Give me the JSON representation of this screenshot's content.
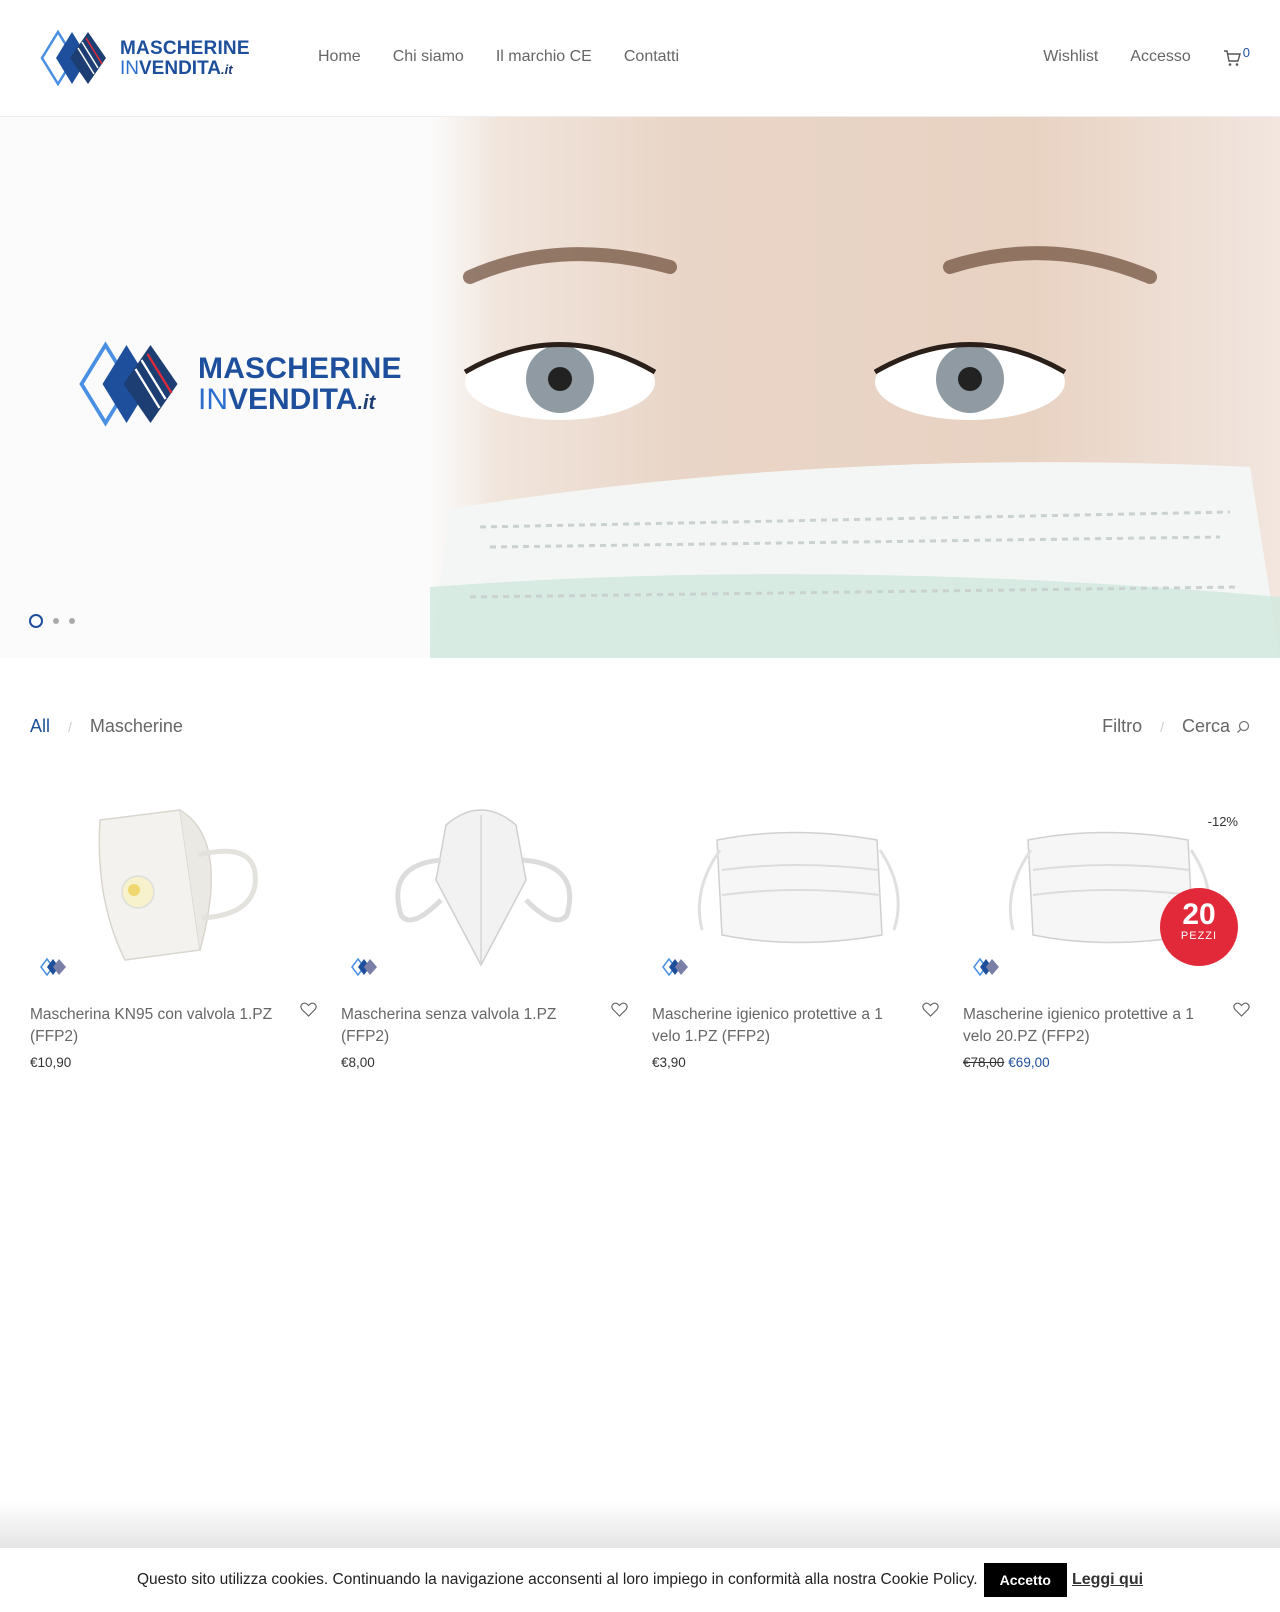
{
  "header": {
    "logo": {
      "line1": "MASCHERINE",
      "line2_in": "IN",
      "line2_vendita": "VENDITA",
      "tld": ".it"
    },
    "nav": [
      "Home",
      "Chi siamo",
      "Il marchio CE",
      "Contatti"
    ],
    "wishlist_label": "Wishlist",
    "login_label": "Accesso",
    "cart_count": "0"
  },
  "hero": {
    "logo": {
      "line1": "MASCHERINE",
      "line2_in": "IN",
      "line2_vendita": "VENDITA",
      "tld": ".it"
    },
    "slides": 3,
    "active_slide": 1
  },
  "filters": {
    "categories": [
      "All",
      "Mascherine"
    ],
    "filter_label": "Filtro",
    "search_label": "Cerca"
  },
  "products": [
    {
      "title": "Mascherina KN95 con valvola 1.PZ (FFP2)",
      "price": "€10,90"
    },
    {
      "title": "Mascherina senza valvola 1.PZ (FFP2)",
      "price": "€8,00"
    },
    {
      "title": "Mascherine igienico protettive a 1 velo 1.PZ (FFP2)",
      "price": "€3,90"
    },
    {
      "title": "Mascherine igienico protettive a 1 velo 20.PZ (FFP2)",
      "old_price": "€78,00",
      "price": "€69,00",
      "sale_badge": "-12%",
      "qty_badge_number": "20",
      "qty_badge_label": "PEZZI"
    }
  ],
  "cookie": {
    "text": "Questo sito utilizza cookies. Continuando la navigazione acconsenti al loro impiego in conformità alla nostra Cookie Policy.",
    "accept_label": "Accetto",
    "read_more_label": "Leggi qui"
  },
  "colors": {
    "brand": "#1d4f9c",
    "badge_red": "#e2293a",
    "cookie_button": "#000000"
  },
  "icons": [
    "cart-icon",
    "search-icon",
    "heart-icon",
    "brand-mark-icon"
  ]
}
